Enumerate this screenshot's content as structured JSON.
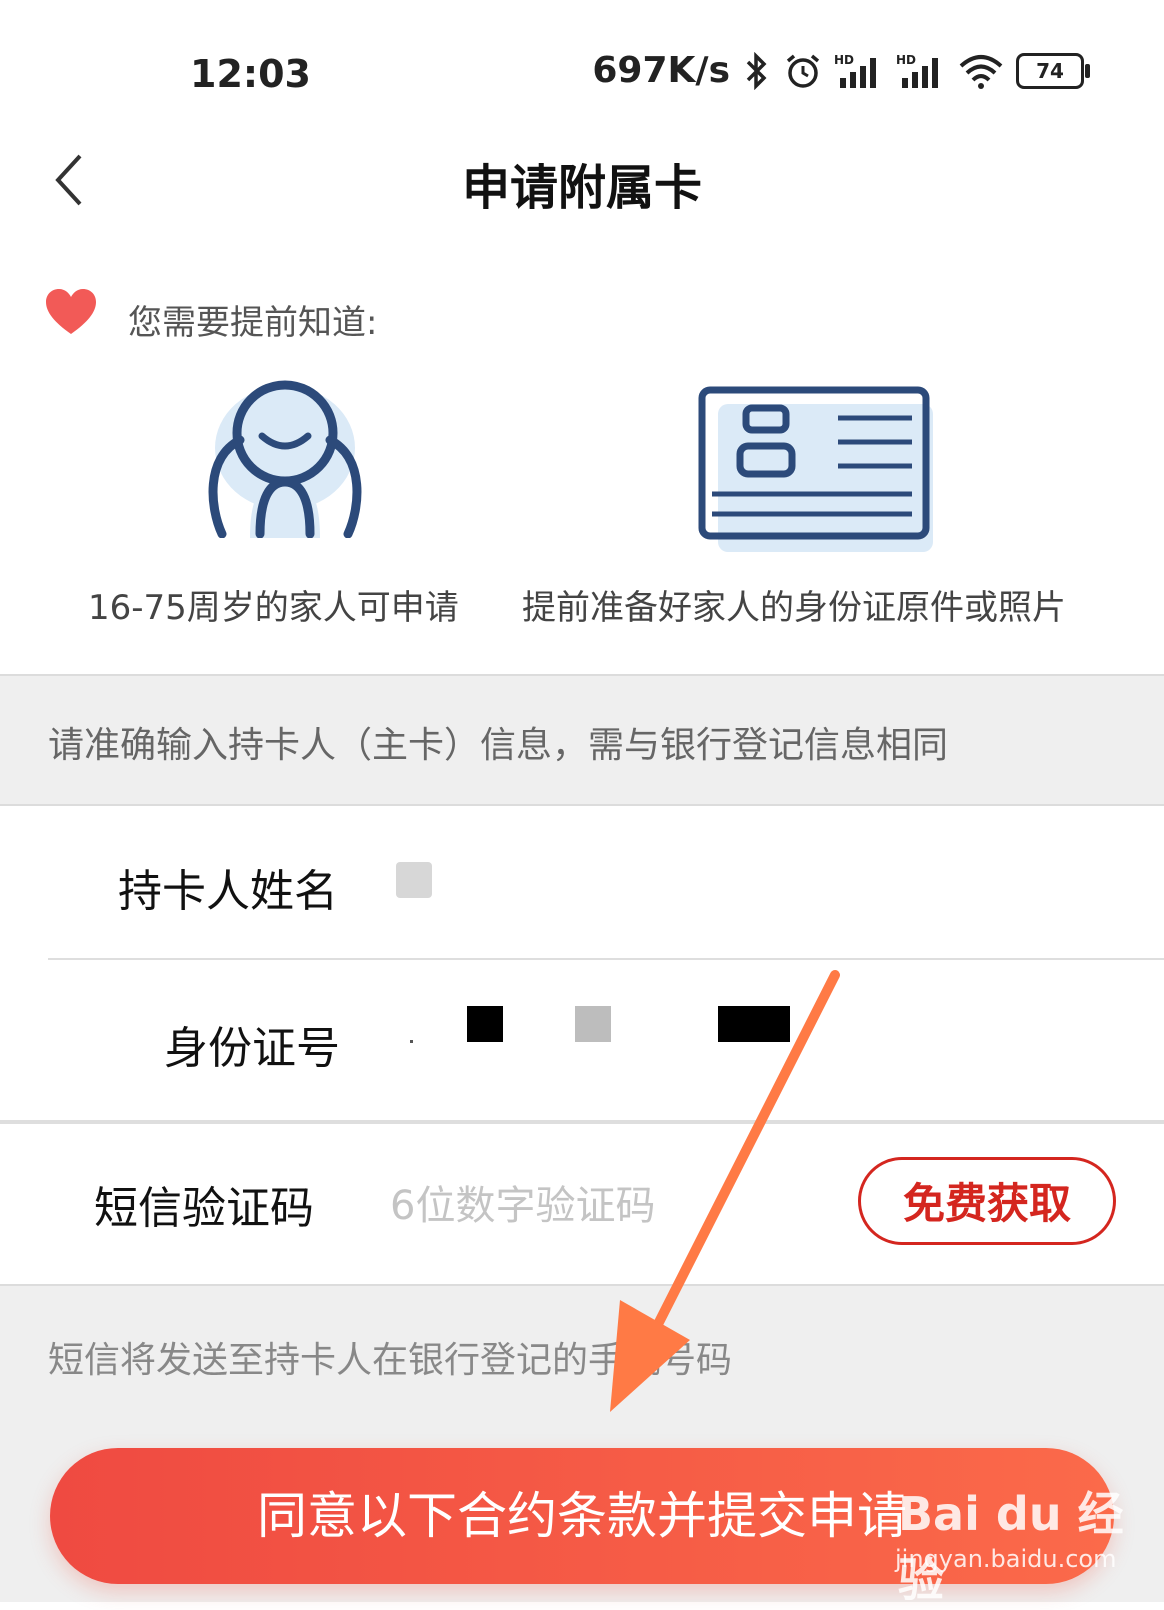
{
  "status_bar": {
    "time": "12:03",
    "net_speed": "697K/s",
    "battery": "74",
    "icons": [
      "bluetooth-icon",
      "alarm-icon",
      "signal-hd-icon",
      "signal-hd-icon",
      "wifi-icon",
      "battery-icon"
    ]
  },
  "header": {
    "title": "申请附属卡",
    "back_icon": "chevron-left-icon"
  },
  "notice": {
    "title": "您需要提前知道:",
    "items": [
      {
        "icon": "person-illustration",
        "caption": "16-75周岁的家人可申请"
      },
      {
        "icon": "id-card-illustration",
        "caption": "提前准备好家人的身份证原件或照片"
      }
    ]
  },
  "info": {
    "text": "请准确输入持卡人（主卡）信息，需与银行登记信息相同"
  },
  "form": {
    "name_label": "持卡人姓名",
    "id_label": "身份证号",
    "sms_label": "短信验证码",
    "sms_placeholder": "6位数字验证码",
    "get_code_label": "免费获取"
  },
  "sms_hint": "短信将发送至持卡人在银行登记的手机号码",
  "submit_label": "同意以下合约条款并提交申请",
  "watermark": {
    "logo": "Bai du 经验",
    "url": "jingyan.baidu.com"
  },
  "colors": {
    "accent": "#d4261f",
    "button": "#f25343",
    "arrow": "#ff7a45",
    "illustration": "#2c4a7a"
  }
}
